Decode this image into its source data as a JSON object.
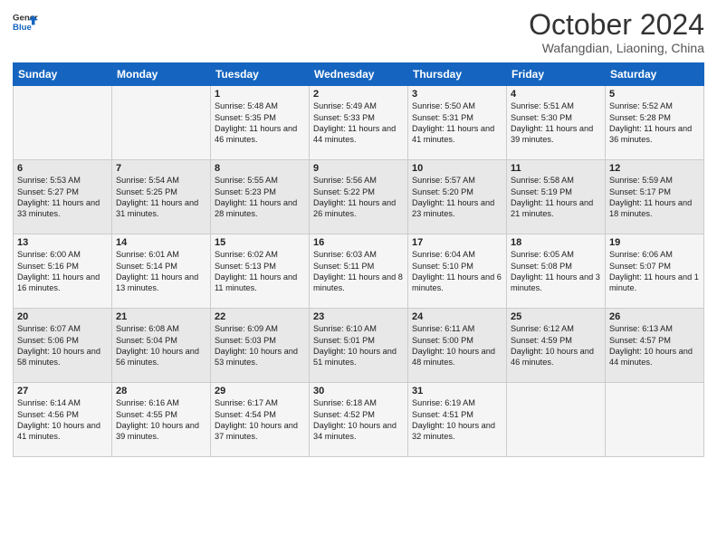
{
  "logo": {
    "line1": "General",
    "line2": "Blue"
  },
  "title": "October 2024",
  "location": "Wafangdian, Liaoning, China",
  "weekdays": [
    "Sunday",
    "Monday",
    "Tuesday",
    "Wednesday",
    "Thursday",
    "Friday",
    "Saturday"
  ],
  "weeks": [
    [
      {
        "day": "",
        "info": ""
      },
      {
        "day": "",
        "info": ""
      },
      {
        "day": "1",
        "info": "Sunrise: 5:48 AM\nSunset: 5:35 PM\nDaylight: 11 hours and 46 minutes."
      },
      {
        "day": "2",
        "info": "Sunrise: 5:49 AM\nSunset: 5:33 PM\nDaylight: 11 hours and 44 minutes."
      },
      {
        "day": "3",
        "info": "Sunrise: 5:50 AM\nSunset: 5:31 PM\nDaylight: 11 hours and 41 minutes."
      },
      {
        "day": "4",
        "info": "Sunrise: 5:51 AM\nSunset: 5:30 PM\nDaylight: 11 hours and 39 minutes."
      },
      {
        "day": "5",
        "info": "Sunrise: 5:52 AM\nSunset: 5:28 PM\nDaylight: 11 hours and 36 minutes."
      }
    ],
    [
      {
        "day": "6",
        "info": "Sunrise: 5:53 AM\nSunset: 5:27 PM\nDaylight: 11 hours and 33 minutes."
      },
      {
        "day": "7",
        "info": "Sunrise: 5:54 AM\nSunset: 5:25 PM\nDaylight: 11 hours and 31 minutes."
      },
      {
        "day": "8",
        "info": "Sunrise: 5:55 AM\nSunset: 5:23 PM\nDaylight: 11 hours and 28 minutes."
      },
      {
        "day": "9",
        "info": "Sunrise: 5:56 AM\nSunset: 5:22 PM\nDaylight: 11 hours and 26 minutes."
      },
      {
        "day": "10",
        "info": "Sunrise: 5:57 AM\nSunset: 5:20 PM\nDaylight: 11 hours and 23 minutes."
      },
      {
        "day": "11",
        "info": "Sunrise: 5:58 AM\nSunset: 5:19 PM\nDaylight: 11 hours and 21 minutes."
      },
      {
        "day": "12",
        "info": "Sunrise: 5:59 AM\nSunset: 5:17 PM\nDaylight: 11 hours and 18 minutes."
      }
    ],
    [
      {
        "day": "13",
        "info": "Sunrise: 6:00 AM\nSunset: 5:16 PM\nDaylight: 11 hours and 16 minutes."
      },
      {
        "day": "14",
        "info": "Sunrise: 6:01 AM\nSunset: 5:14 PM\nDaylight: 11 hours and 13 minutes."
      },
      {
        "day": "15",
        "info": "Sunrise: 6:02 AM\nSunset: 5:13 PM\nDaylight: 11 hours and 11 minutes."
      },
      {
        "day": "16",
        "info": "Sunrise: 6:03 AM\nSunset: 5:11 PM\nDaylight: 11 hours and 8 minutes."
      },
      {
        "day": "17",
        "info": "Sunrise: 6:04 AM\nSunset: 5:10 PM\nDaylight: 11 hours and 6 minutes."
      },
      {
        "day": "18",
        "info": "Sunrise: 6:05 AM\nSunset: 5:08 PM\nDaylight: 11 hours and 3 minutes."
      },
      {
        "day": "19",
        "info": "Sunrise: 6:06 AM\nSunset: 5:07 PM\nDaylight: 11 hours and 1 minute."
      }
    ],
    [
      {
        "day": "20",
        "info": "Sunrise: 6:07 AM\nSunset: 5:06 PM\nDaylight: 10 hours and 58 minutes."
      },
      {
        "day": "21",
        "info": "Sunrise: 6:08 AM\nSunset: 5:04 PM\nDaylight: 10 hours and 56 minutes."
      },
      {
        "day": "22",
        "info": "Sunrise: 6:09 AM\nSunset: 5:03 PM\nDaylight: 10 hours and 53 minutes."
      },
      {
        "day": "23",
        "info": "Sunrise: 6:10 AM\nSunset: 5:01 PM\nDaylight: 10 hours and 51 minutes."
      },
      {
        "day": "24",
        "info": "Sunrise: 6:11 AM\nSunset: 5:00 PM\nDaylight: 10 hours and 48 minutes."
      },
      {
        "day": "25",
        "info": "Sunrise: 6:12 AM\nSunset: 4:59 PM\nDaylight: 10 hours and 46 minutes."
      },
      {
        "day": "26",
        "info": "Sunrise: 6:13 AM\nSunset: 4:57 PM\nDaylight: 10 hours and 44 minutes."
      }
    ],
    [
      {
        "day": "27",
        "info": "Sunrise: 6:14 AM\nSunset: 4:56 PM\nDaylight: 10 hours and 41 minutes."
      },
      {
        "day": "28",
        "info": "Sunrise: 6:16 AM\nSunset: 4:55 PM\nDaylight: 10 hours and 39 minutes."
      },
      {
        "day": "29",
        "info": "Sunrise: 6:17 AM\nSunset: 4:54 PM\nDaylight: 10 hours and 37 minutes."
      },
      {
        "day": "30",
        "info": "Sunrise: 6:18 AM\nSunset: 4:52 PM\nDaylight: 10 hours and 34 minutes."
      },
      {
        "day": "31",
        "info": "Sunrise: 6:19 AM\nSunset: 4:51 PM\nDaylight: 10 hours and 32 minutes."
      },
      {
        "day": "",
        "info": ""
      },
      {
        "day": "",
        "info": ""
      }
    ]
  ]
}
